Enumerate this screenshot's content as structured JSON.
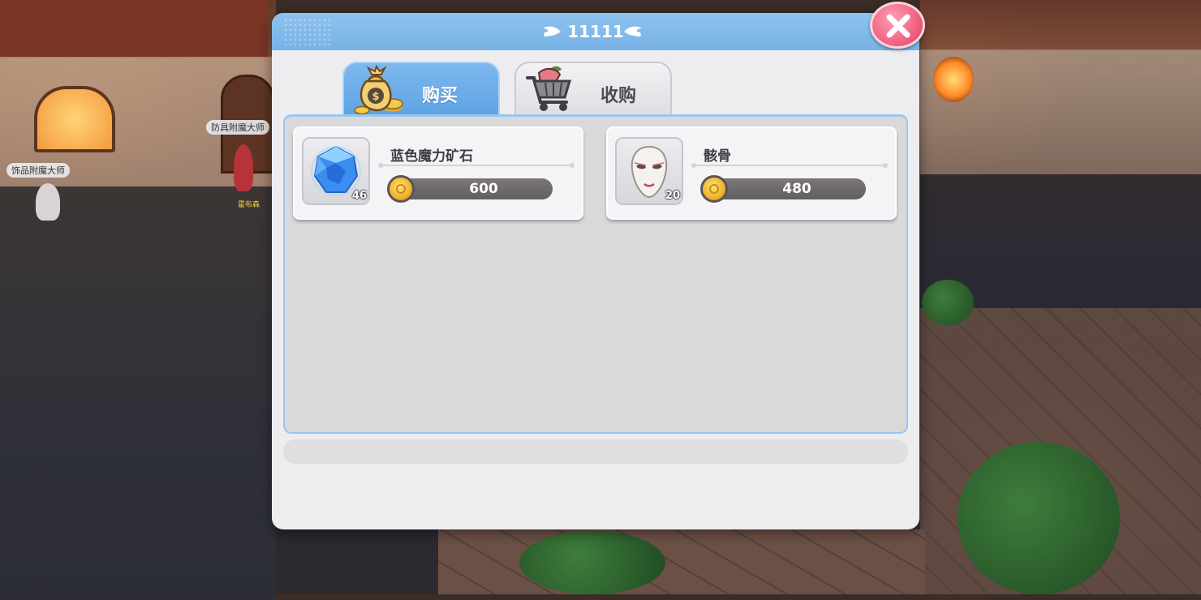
{
  "window": {
    "title": "11111",
    "close_icon": "close-icon"
  },
  "tabs": [
    {
      "label": "购买",
      "icon": "money-bag-icon",
      "active": true
    },
    {
      "label": "收购",
      "icon": "shopping-cart-icon",
      "active": false
    }
  ],
  "items": [
    {
      "name": "蓝色魔力矿石",
      "count": "46",
      "price": "600",
      "icon": "blue-crystal-icon",
      "currency_icon": "gold-coin-icon"
    },
    {
      "name": "骸骨",
      "count": "20",
      "price": "480",
      "icon": "mask-icon",
      "currency_icon": "gold-coin-icon"
    }
  ],
  "background": {
    "npcs": [
      {
        "name": "饰品附魔大师"
      },
      {
        "name": "防具附魔大师"
      },
      {
        "name": "霍布森"
      }
    ]
  },
  "colors": {
    "header_blue": "#78b2e6",
    "close_pink": "#ee5f7e",
    "price_bar": "#6b6567",
    "coin_gold": "#f0b42b"
  }
}
